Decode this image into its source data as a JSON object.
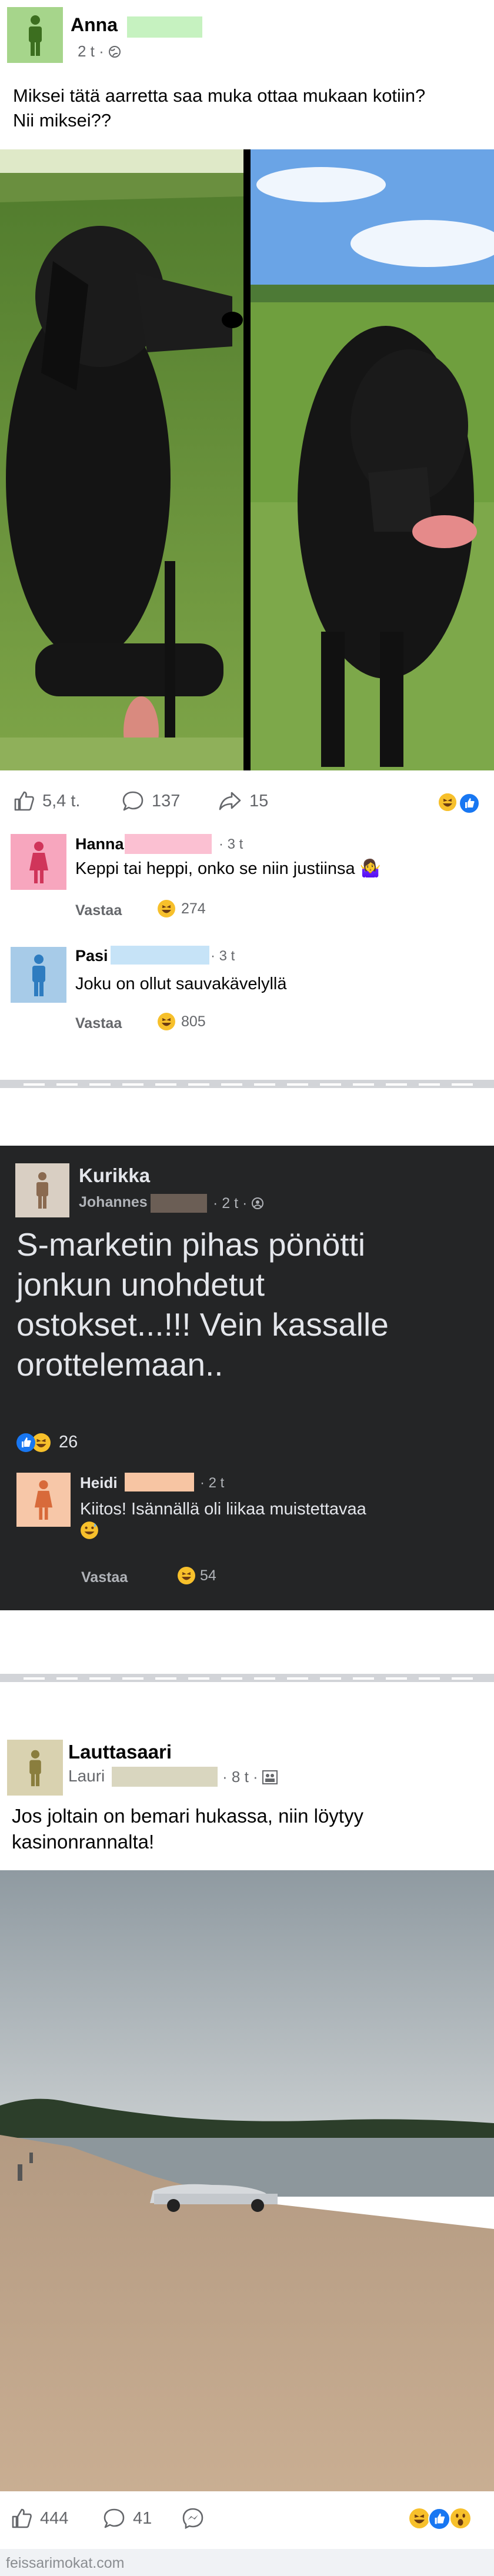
{
  "post1": {
    "author": "Anna",
    "time": "2 t ·",
    "text_line1": "Miksei tätä aarretta saa muka ottaa mukaan kotiin?",
    "text_line2": "Nii miksei??",
    "likes": "5,4 t.",
    "comments": "137",
    "shares": "15",
    "comments_list": [
      {
        "name": "Hanna",
        "time": "· 3 t",
        "text": "Keppi tai heppi, onko se niin justiinsa 🤷‍♀️",
        "reply": "Vastaa",
        "reactions": "274"
      },
      {
        "name": "Pasi",
        "time": "· 3 t",
        "text": "Joku on ollut sauvakävelyllä",
        "reply": "Vastaa",
        "reactions": "805"
      }
    ]
  },
  "post2": {
    "group": "Kurikka",
    "author": "Johannes",
    "time": "· 2 t ·",
    "text_line1": "S-marketin pihas pönötti",
    "text_line2": "jonkun unohdetut",
    "text_line3": "ostokset...!!! Vein kassalle",
    "text_line4": "orottelemaan..",
    "reactions": "26",
    "comment": {
      "name": "Heidi",
      "time": "· 2 t",
      "text": "Kiitos! Isännällä oli liikaa muistettavaa",
      "reply": "Vastaa",
      "reactions": "54"
    }
  },
  "post3": {
    "group": "Lauttasaari",
    "author": "Lauri",
    "time": "· 8 t ·",
    "text_line1": "Jos joltain on bemari hukassa, niin löytyy",
    "text_line2": "kasinonrannalta!",
    "likes": "444",
    "comments": "41"
  },
  "footer": {
    "watermark": "feissarimokat.com"
  },
  "colors": {
    "accent": "#1877f2",
    "avatar_green": "#a6d58b",
    "avatar_pink": "#f7a6be",
    "avatar_blue": "#a7cbe8",
    "dark_bg": "#242526"
  }
}
